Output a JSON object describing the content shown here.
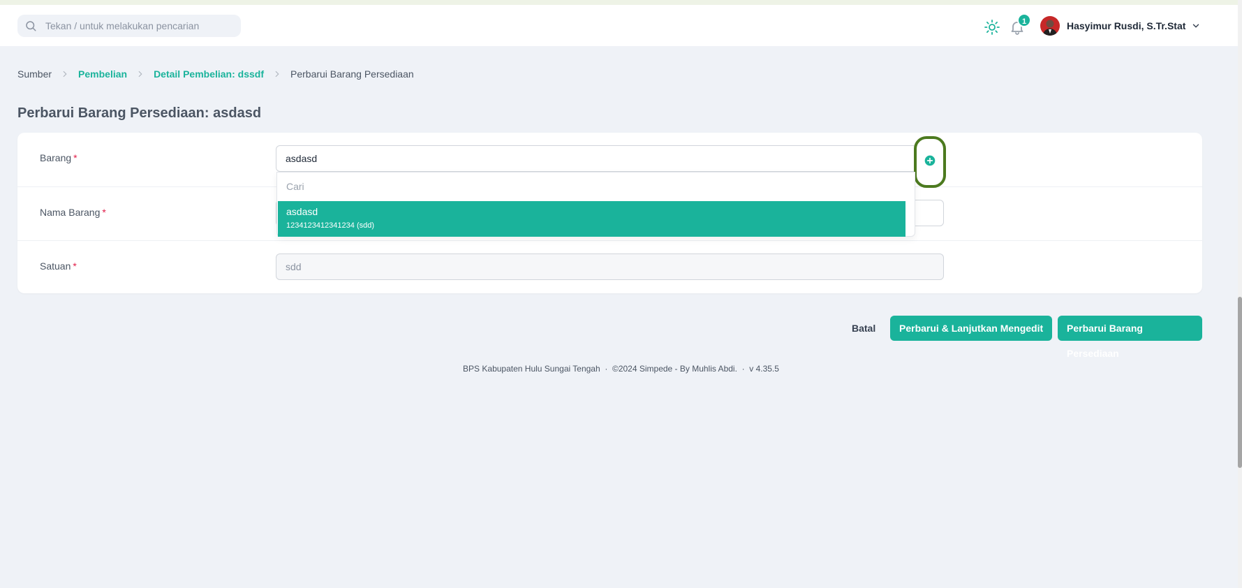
{
  "topbar": {
    "search_placeholder": "Tekan / untuk melakukan pencarian",
    "notification_count": "1",
    "user_name": "Hasyimur Rusdi, S.Tr.Stat"
  },
  "breadcrumb": {
    "items": [
      "Sumber",
      "Pembelian",
      "Detail Pembelian: dssdf",
      "Perbarui Barang Persediaan"
    ]
  },
  "page": {
    "title": "Perbarui Barang Persediaan: asdasd"
  },
  "form": {
    "fields": [
      {
        "label": "Barang",
        "required": "*",
        "value": "asdasd"
      },
      {
        "label": "Nama Barang",
        "required": "*",
        "value": ""
      },
      {
        "label": "Satuan",
        "required": "*",
        "value": "sdd"
      }
    ],
    "dropdown": {
      "search_placeholder": "Cari",
      "options": [
        {
          "title": "asdasd",
          "subtitle": "1234123412341234 (sdd)"
        }
      ]
    }
  },
  "actions": {
    "cancel": "Batal",
    "update_continue": "Perbarui & Lanjutkan Mengedit",
    "update": "Perbarui Barang Persediaan"
  },
  "footer": {
    "text": "BPS Kabupaten Hulu Sungai Tengah  ·  ©2024 Simpede - By Muhlis Abdi.  ·  v 4.35.5"
  },
  "colors": {
    "accent": "#1ab39b",
    "highlight_outline": "#4c7a1f",
    "background": "#eff2f7",
    "required": "#e11d48"
  },
  "icons": [
    "search-icon",
    "sun-icon",
    "bell-icon",
    "avatar",
    "chevron-down-icon",
    "chevron-right-icon",
    "close-icon",
    "plus-circle-icon"
  ]
}
